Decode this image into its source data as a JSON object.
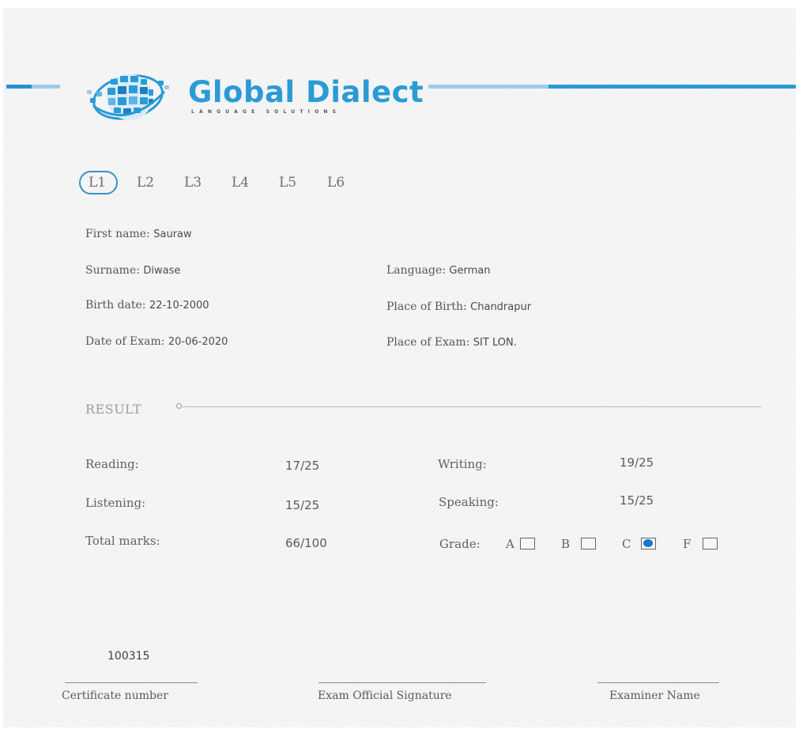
{
  "brand": {
    "name": "Global Dialect",
    "tagline": "LANGUAGE SOLUTIONS",
    "color": "#2a9bd6"
  },
  "levels": {
    "items": [
      "L1",
      "L2",
      "L3",
      "L4",
      "L5",
      "L6"
    ],
    "selected": "L1"
  },
  "candidate": {
    "first_name_label": "First name:",
    "first_name": "Sauraw",
    "surname_label": "Surname:",
    "surname": "Diwase",
    "language_label": "Language:",
    "language": "German",
    "birth_date_label": "Birth date:",
    "birth_date": "22-10-2000",
    "place_of_birth_label": "Place of Birth:",
    "place_of_birth": "Chandrapur",
    "date_of_exam_label": "Date of Exam:",
    "date_of_exam": "20-06-2020",
    "place_of_exam_label": "Place of Exam:",
    "place_of_exam": "SIT LON."
  },
  "result": {
    "title": "RESULT",
    "reading_label": "Reading:",
    "reading": "17/25",
    "writing_label": "Writing:",
    "writing": "19/25",
    "listening_label": "Listening:",
    "listening": "15/25",
    "speaking_label": "Speaking:",
    "speaking": "15/25",
    "total_label": "Total marks:",
    "total": "66/100",
    "grade_label": "Grade:",
    "grades": [
      "A",
      "B",
      "C",
      "F"
    ],
    "selected_grade": "C",
    "selected_color": "#1976c9"
  },
  "footer": {
    "certificate_number": "100315",
    "certificate_label": "Certificate number",
    "signature_label": "Exam Official Signature",
    "examiner_label": "Examiner Name"
  }
}
